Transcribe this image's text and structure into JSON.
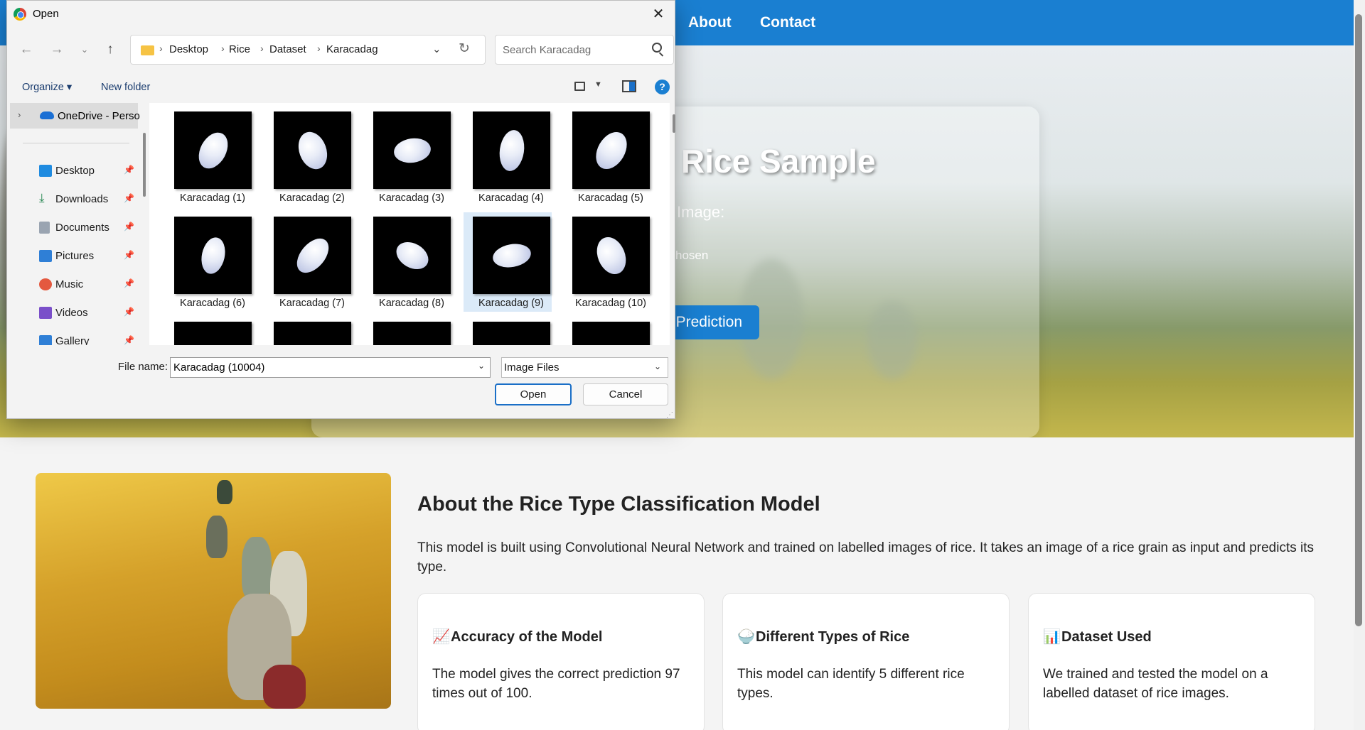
{
  "webpage": {
    "nav": [
      "About",
      "Contact"
    ],
    "hero": {
      "title": "Rice Sample",
      "subtitle": "Image:",
      "file_status": "hosen",
      "button": "Prediction"
    },
    "about": {
      "title": "About the Rice Type Classification Model",
      "text": "This model is built using Convolutional Neural Network and trained on labelled images of rice. It takes an image of a rice grain as input and predicts its type.",
      "cards": [
        {
          "icon": "📈",
          "title": "Accuracy of the Model",
          "text": "The model gives the correct prediction 97 times out of 100."
        },
        {
          "icon": "🍚",
          "title": "Different Types of Rice",
          "text": "This model can identify 5 different rice types."
        },
        {
          "icon": "📊",
          "title": "Dataset Used",
          "text": "We trained and tested the model on a labelled dataset of rice images."
        }
      ]
    }
  },
  "dialog": {
    "title": "Open",
    "breadcrumb": [
      "Desktop",
      "Rice",
      "Dataset",
      "Karacadag"
    ],
    "search_placeholder": "Search Karacadag",
    "toolbar": {
      "organize": "Organize ▾",
      "new_folder": "New folder",
      "help": "?"
    },
    "nav_pane": {
      "onedrive": "OneDrive - Perso",
      "items": [
        {
          "label": "Desktop",
          "icon": "desktop-icon",
          "color": "#1f8be0"
        },
        {
          "label": "Downloads",
          "icon": "download-icon",
          "color": "#2e8b57"
        },
        {
          "label": "Documents",
          "icon": "documents-icon",
          "color": "#9aa4b1"
        },
        {
          "label": "Pictures",
          "icon": "pictures-icon",
          "color": "#2f7fd6"
        },
        {
          "label": "Music",
          "icon": "music-icon",
          "color": "#e4593f"
        },
        {
          "label": "Videos",
          "icon": "videos-icon",
          "color": "#7a4fc9"
        },
        {
          "label": "Gallery",
          "icon": "gallery-icon",
          "color": "#2f7fd6"
        }
      ]
    },
    "files": [
      "Karacadag (1)",
      "Karacadag (2)",
      "Karacadag (3)",
      "Karacadag (4)",
      "Karacadag (5)",
      "Karacadag (6)",
      "Karacadag (7)",
      "Karacadag (8)",
      "Karacadag (9)",
      "Karacadag (10)"
    ],
    "selected_file": "Karacadag (9)",
    "file_name_label": "File name:",
    "file_name_value": "Karacadag (10004)",
    "file_type": "Image Files",
    "open_label": "Open",
    "cancel_label": "Cancel"
  },
  "colors": {
    "accent": "#1a7fd1",
    "selection": "#dbeaf8"
  }
}
